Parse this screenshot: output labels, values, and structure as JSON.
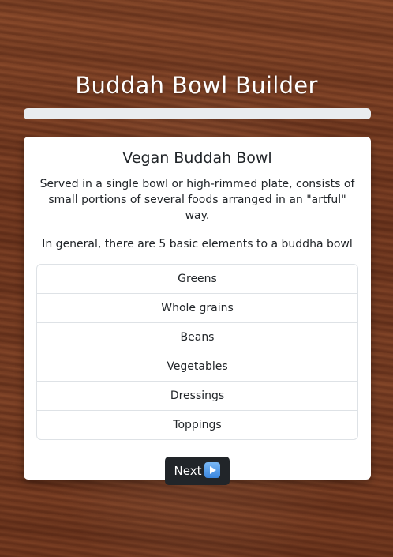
{
  "header": {
    "title": "Buddah Bowl Builder",
    "progress": 0
  },
  "card": {
    "title": "Vegan Buddah Bowl",
    "description": "Served in a single bowl or high-rimmed plate, consists of small portions of several foods arranged in an \"artful\" way.",
    "note": "In general, there are 5 basic elements to a buddha bowl",
    "elements": [
      "Greens",
      "Whole grains",
      "Beans",
      "Vegetables",
      "Dressings",
      "Toppings"
    ],
    "next_label": "Next",
    "next_icon": "play-button-icon"
  },
  "colors": {
    "button": "#212529",
    "progress_track": "#e9ecef",
    "card_bg": "#ffffff"
  }
}
